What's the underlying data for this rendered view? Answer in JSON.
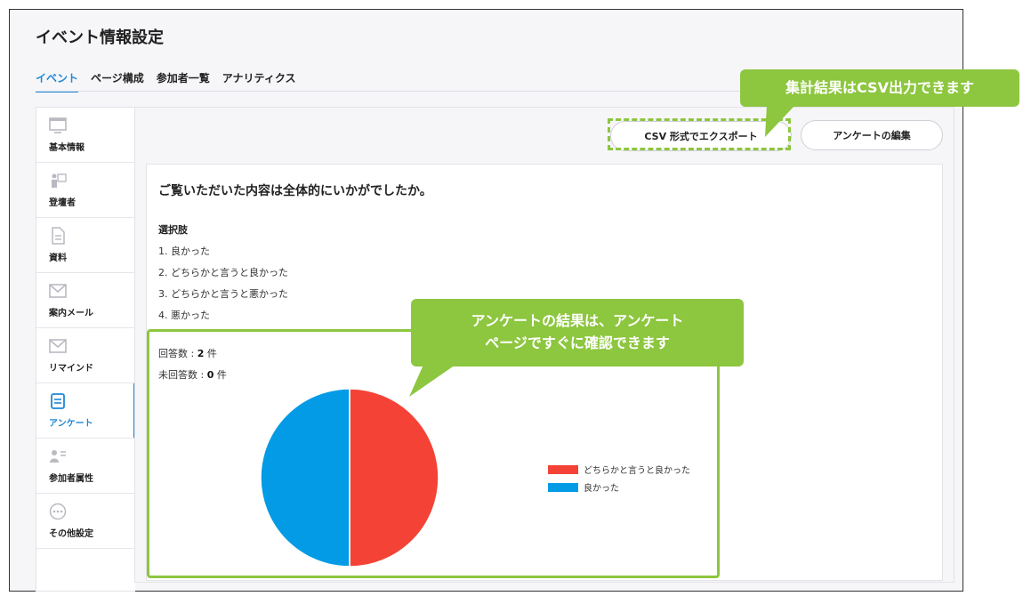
{
  "page_title": "イベント情報設定",
  "tabs": [
    {
      "label": "イベント",
      "active": true
    },
    {
      "label": "ページ構成"
    },
    {
      "label": "参加者一覧"
    },
    {
      "label": "アナリティクス"
    }
  ],
  "sidebar": {
    "items": [
      {
        "label": "基本情報",
        "icon": "monitor-icon"
      },
      {
        "label": "登壇者",
        "icon": "presenter-icon"
      },
      {
        "label": "資料",
        "icon": "document-icon"
      },
      {
        "label": "案内メール",
        "icon": "mail-icon"
      },
      {
        "label": "リマインド",
        "icon": "mail-icon"
      },
      {
        "label": "アンケート",
        "icon": "survey-icon",
        "active": true
      },
      {
        "label": "参加者属性",
        "icon": "user-list-icon"
      },
      {
        "label": "その他設定",
        "icon": "more-icon"
      }
    ]
  },
  "toolbar": {
    "csv_export_label": "CSV 形式でエクスポート",
    "edit_survey_label": "アンケートの編集"
  },
  "survey": {
    "question": "ご覧いただいた内容は全体的にいかがでしたか。",
    "options_heading": "選択肢",
    "options": [
      "1. 良かった",
      "2. どちらかと言うと良かった",
      "3. どちらかと言うと悪かった",
      "4. 悪かった"
    ],
    "answered_label": "回答数 : ",
    "answered_count": "2",
    "unanswered_label": "未回答数 : ",
    "unanswered_count": "0",
    "count_unit": " 件"
  },
  "callouts": {
    "csv": "集計結果はCSV出力できます",
    "results_line1": "アンケートの結果は、アンケート",
    "results_line2": "ページですぐに確認できます"
  },
  "colors": {
    "accent": "#1e88d6",
    "callout_green": "#8dc63f",
    "pie_red": "#f44336",
    "pie_blue": "#039be5"
  },
  "chart_data": {
    "type": "pie",
    "labels": [
      "どちらかと言うと良かった",
      "良かった"
    ],
    "values": [
      1,
      1
    ],
    "colors": [
      "#f44336",
      "#039be5"
    ],
    "legend_position": "right"
  }
}
